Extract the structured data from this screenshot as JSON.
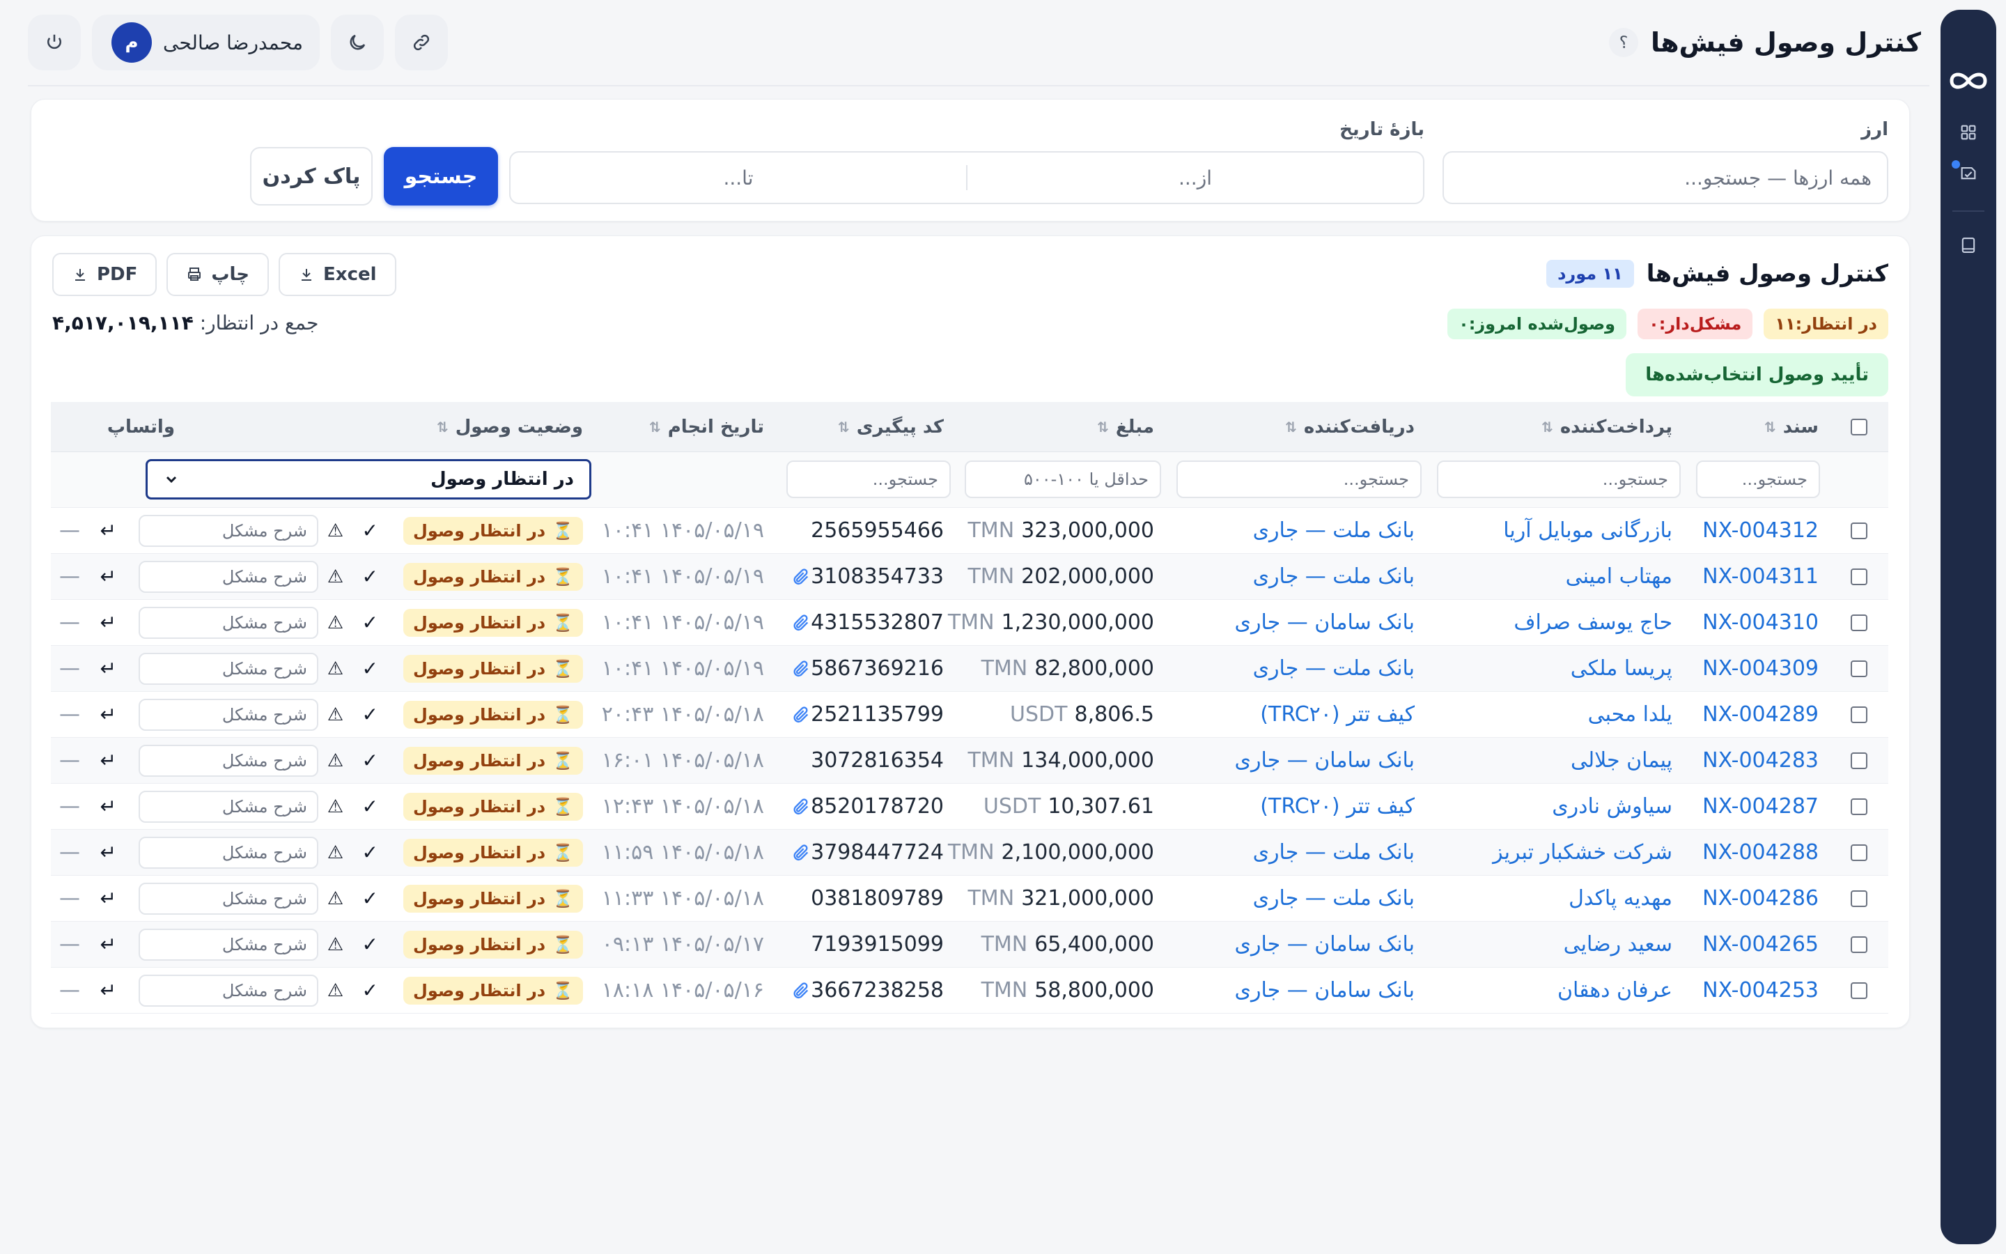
{
  "header": {
    "title": "کنترل وصول فیش‌ها",
    "help_label": "؟",
    "user_name": "محمدرضا صالحی",
    "user_initial": "م"
  },
  "sidebar": {
    "icons": [
      "infinity-logo-icon",
      "dashboard-grid-icon",
      "receipt-check-icon",
      "book-icon"
    ]
  },
  "filters": {
    "currency_label": "ارز",
    "currency_placeholder": "همه ارزها — جستجو...",
    "date_label": "بازهٔ تاریخ",
    "date_from_placeholder": "از...",
    "date_to_placeholder": "تا...",
    "search_button": "جستجو",
    "clear_button": "پاک کردن"
  },
  "main": {
    "title": "کنترل وصول فیش‌ها",
    "count_badge": "۱۱ مورد",
    "export": {
      "excel": "Excel",
      "print": "چاپ",
      "pdf": "PDF"
    },
    "chips": {
      "pending": "در انتظار:۱۱",
      "problem": "مشکل‌دار:۰",
      "received_today": "وصول‌شده امروز:۰"
    },
    "total_label": "جمع در انتظار:",
    "total_value": "۴,۵۱۷,۰۱۹,۱۱۴",
    "confirm_selected": "تأیید وصول انتخاب‌شده‌ها"
  },
  "table": {
    "columns": {
      "doc": "سند",
      "payer": "پرداخت‌کننده",
      "receiver": "دریافت‌کننده",
      "amount": "مبلغ",
      "tracking": "کد پیگیری",
      "date": "تاریخ انجام",
      "status": "وضعیت وصول",
      "whatsapp": "واتساپ"
    },
    "filter_row": {
      "doc_placeholder": "جستجو...",
      "payer_placeholder": "جستجو...",
      "receiver_placeholder": "جستجو...",
      "amount_placeholder": "حداقل یا ۱۰۰-۵۰۰",
      "tracking_placeholder": "جستجو...",
      "status_selected": "در انتظار وصول"
    },
    "status_label": "در انتظار وصول",
    "note_placeholder": "شرح مشکل",
    "whatsapp_empty": "—",
    "rows": [
      {
        "doc": "NX-004312",
        "payer": "بازرگانی موبایل آریا",
        "receiver": "بانک ملت — جاری",
        "amount": "323,000,000",
        "currency": "TMN",
        "tracking": "2565955466",
        "attachment": false,
        "date": "۱۴۰۵/۰۵/۱۹ ۱۰:۴۱"
      },
      {
        "doc": "NX-004311",
        "payer": "مهتاب امینی",
        "receiver": "بانک ملت — جاری",
        "amount": "202,000,000",
        "currency": "TMN",
        "tracking": "3108354733",
        "attachment": true,
        "date": "۱۴۰۵/۰۵/۱۹ ۱۰:۴۱"
      },
      {
        "doc": "NX-004310",
        "payer": "حاج یوسف صراف",
        "receiver": "بانک سامان — جاری",
        "amount": "1,230,000,000",
        "currency": "TMN",
        "tracking": "4315532807",
        "attachment": true,
        "date": "۱۴۰۵/۰۵/۱۹ ۱۰:۴۱"
      },
      {
        "doc": "NX-004309",
        "payer": "پریسا ملکی",
        "receiver": "بانک ملت — جاری",
        "amount": "82,800,000",
        "currency": "TMN",
        "tracking": "5867369216",
        "attachment": true,
        "date": "۱۴۰۵/۰۵/۱۹ ۱۰:۴۱"
      },
      {
        "doc": "NX-004289",
        "payer": "یلدا محبی",
        "receiver": "کیف تتر (TRC۲۰)",
        "amount": "8,806.5",
        "currency": "USDT",
        "tracking": "2521135799",
        "attachment": true,
        "date": "۱۴۰۵/۰۵/۱۸ ۲۰:۴۳"
      },
      {
        "doc": "NX-004283",
        "payer": "پیمان جلالی",
        "receiver": "بانک سامان — جاری",
        "amount": "134,000,000",
        "currency": "TMN",
        "tracking": "3072816354",
        "attachment": false,
        "date": "۱۴۰۵/۰۵/۱۸ ۱۶:۰۱"
      },
      {
        "doc": "NX-004287",
        "payer": "سیاوش نادری",
        "receiver": "کیف تتر (TRC۲۰)",
        "amount": "10,307.61",
        "currency": "USDT",
        "tracking": "8520178720",
        "attachment": true,
        "date": "۱۴۰۵/۰۵/۱۸ ۱۲:۴۳"
      },
      {
        "doc": "NX-004288",
        "payer": "شرکت خشکبار تبریز",
        "receiver": "بانک ملت — جاری",
        "amount": "2,100,000,000",
        "currency": "TMN",
        "tracking": "3798447724",
        "attachment": true,
        "date": "۱۴۰۵/۰۵/۱۸ ۱۱:۵۹"
      },
      {
        "doc": "NX-004286",
        "payer": "مهدیه پاکدل",
        "receiver": "بانک ملت — جاری",
        "amount": "321,000,000",
        "currency": "TMN",
        "tracking": "0381809789",
        "attachment": false,
        "date": "۱۴۰۵/۰۵/۱۸ ۱۱:۳۳"
      },
      {
        "doc": "NX-004265",
        "payer": "سعید رضایی",
        "receiver": "بانک سامان — جاری",
        "amount": "65,400,000",
        "currency": "TMN",
        "tracking": "7193915099",
        "attachment": false,
        "date": "۱۴۰۵/۰۵/۱۷ ۰۹:۱۳"
      },
      {
        "doc": "NX-004253",
        "payer": "عرفان دهقان",
        "receiver": "بانک سامان — جاری",
        "amount": "58,800,000",
        "currency": "TMN",
        "tracking": "3667238258",
        "attachment": true,
        "date": "۱۴۰۵/۰۵/۱۶ ۱۸:۱۸"
      }
    ]
  },
  "colors": {
    "sidebar": "#1e2a47",
    "primary": "#1d4ed8",
    "link": "#1d6fd8",
    "pending_bg": "#fef3c7",
    "pending_fg": "#92400e",
    "problem_fg": "#b91c1c",
    "success_fg": "#166534"
  }
}
